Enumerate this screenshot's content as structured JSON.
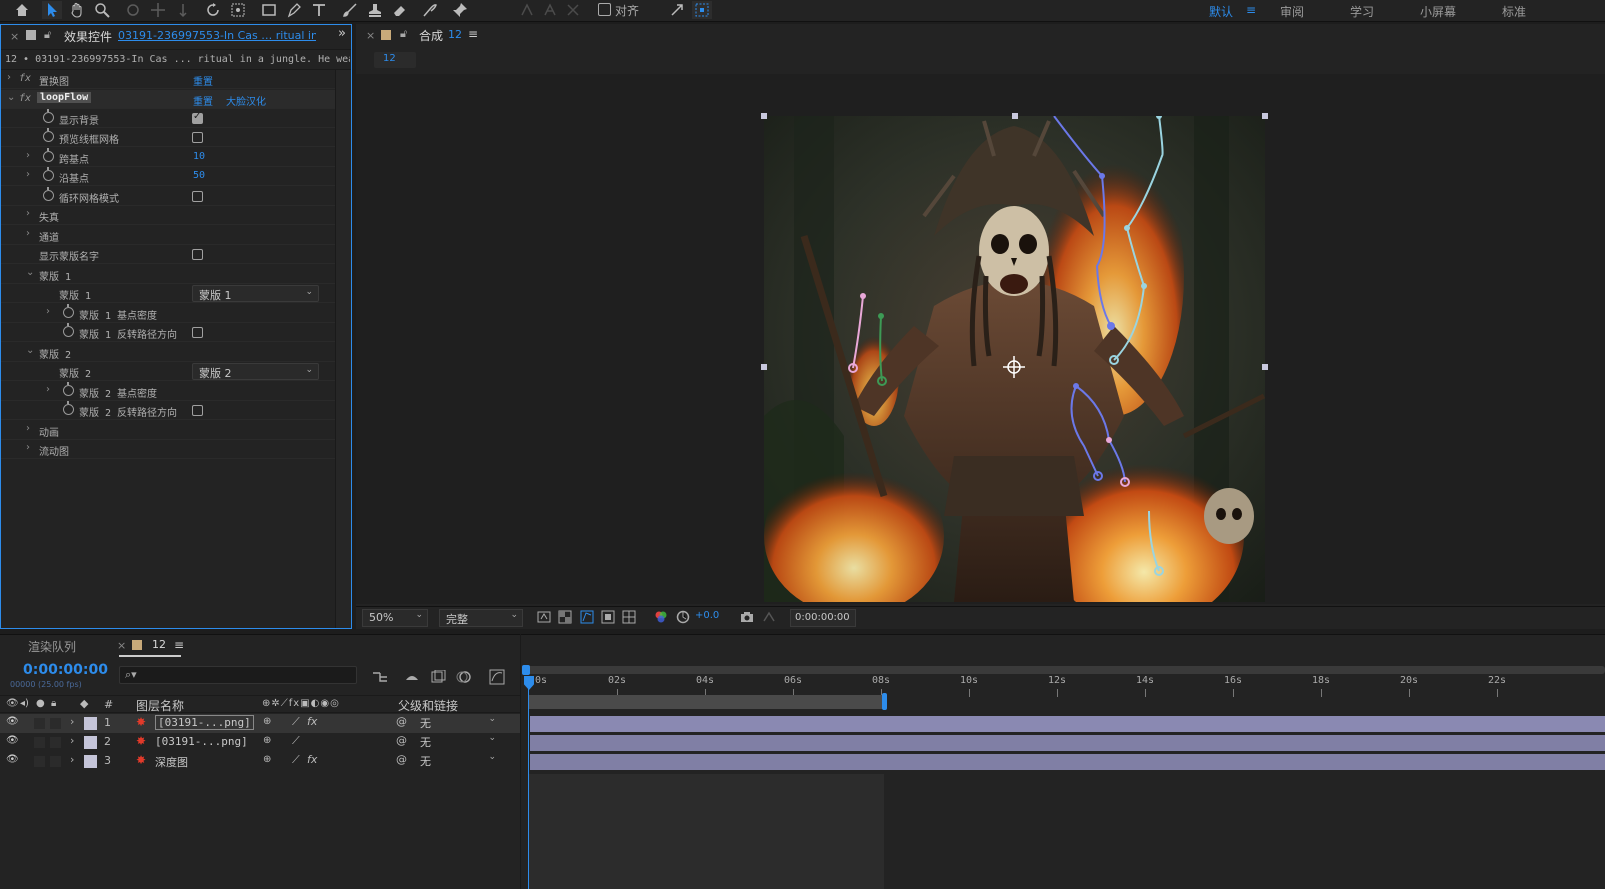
{
  "workspaces": {
    "items": [
      {
        "label": "默认",
        "active": true
      },
      {
        "label": "审阅"
      },
      {
        "label": "学习"
      },
      {
        "label": "小屏幕"
      },
      {
        "label": "标准"
      }
    ]
  },
  "toolbar": {
    "align_label": "对齐",
    "tools": [
      "home-icon",
      "selection-tool-icon",
      "hand-tool-icon",
      "zoom-tool-icon",
      "orbit-camera-icon",
      "pan-camera-icon",
      "dolly-camera-icon",
      "rotate-tool-icon",
      "pan-behind-icon",
      "rectangle-tool-icon",
      "pen-tool-icon",
      "type-tool-icon",
      "brush-tool-icon",
      "clone-stamp-icon",
      "eraser-tool-icon",
      "roto-brush-icon",
      "puppet-pin-icon"
    ]
  },
  "effect_controls": {
    "tab_title": "效果控件",
    "tab_layer": "03191-236997553-In Cas … ritual in a jun",
    "subheader": "12 • 03191-236997553-In Cas ... ritual in a jungle. He wears",
    "effects": [
      {
        "name": "置换图",
        "reset": "重置"
      },
      {
        "name": "loopFlow",
        "reset": "重置",
        "extra": "大脸汉化"
      }
    ],
    "rows": {
      "show_bg": "显示背景",
      "preview_grid": "预览线框网格",
      "span_points": "跨基点",
      "span_points_val": "10",
      "edge_points": "沿基点",
      "edge_points_val": "50",
      "loop_grid": "循环网格模式",
      "distortion": "失真",
      "channel": "通道",
      "show_mask_names": "显示蒙版名字",
      "mask1_group": "蒙版 1",
      "mask1": "蒙版 1",
      "mask1_value": "蒙版 1",
      "mask1_density": "蒙版 1 基点密度",
      "mask1_reverse": "蒙版 1 反转路径方向",
      "mask2_group": "蒙版 2",
      "mask2": "蒙版 2",
      "mask2_value": "蒙版 2",
      "mask2_density": "蒙版 2 基点密度",
      "mask2_reverse": "蒙版 2 反转路径方向",
      "animation": "动画",
      "flow_map": "流动图"
    }
  },
  "composition": {
    "tab_title": "合成",
    "comp_name": "12",
    "sub_tab": "12",
    "zoom": "50%",
    "resolution": "完整",
    "exposure": "+0.0",
    "timecode": "0:00:00:00"
  },
  "timeline": {
    "render_queue_tab": "渲染队列",
    "comp_tab": "12",
    "current_time": "0:00:00:00",
    "frame_info": "00000 (25.00 fps)",
    "search_placeholder": "",
    "col_layer_name": "图层名称",
    "col_parent": "父级和链接",
    "col_hash": "#",
    "layers": [
      {
        "num": "1",
        "name": "[03191-...png]",
        "parent": "无",
        "color": "#c4c4d8"
      },
      {
        "num": "2",
        "name": "[03191-...png]",
        "parent": "无",
        "color": "#c4c4d8"
      },
      {
        "num": "3",
        "name": "深度图",
        "parent": "无",
        "color": "#c4c4d8"
      }
    ],
    "ruler": [
      "0s",
      "02s",
      "04s",
      "06s",
      "08s",
      "10s",
      "12s",
      "14s",
      "16s",
      "18s",
      "20s",
      "22s"
    ],
    "work_area_end_fraction": 0.336
  }
}
